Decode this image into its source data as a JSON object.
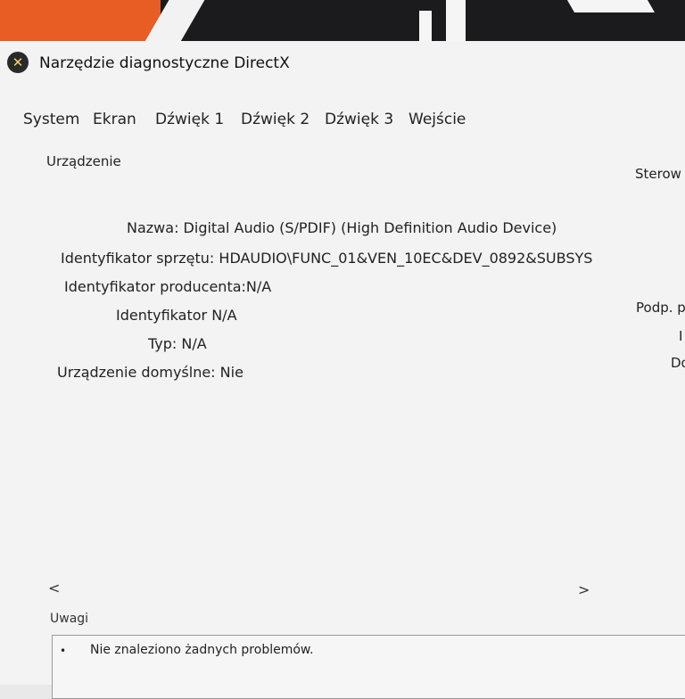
{
  "window": {
    "title": "Narzędzie diagnostyczne DirectX",
    "icon": "directx-icon"
  },
  "tabs": [
    "System",
    "Ekran",
    "Dźwięk 1",
    "Dźwięk 2",
    "Dźwięk 3",
    "Wejście"
  ],
  "device": {
    "group_label": "Urządzenie",
    "fields": [
      {
        "label": "Nazwa:",
        "value": "Digital Audio (S/PDIF) (High Definition Audio Device)"
      },
      {
        "label": "Identyfikator sprzętu:",
        "value": "HDAUDIO\\FUNC_01&VEN_10EC&DEV_0892&SUBSYS"
      },
      {
        "label": "Identyfikator producenta:",
        "value": "N/A"
      },
      {
        "label": "Identyfikator",
        "value": "N/A"
      },
      {
        "label": "Typ:",
        "value": "N/A"
      },
      {
        "label": "Urządzenie domyślne:",
        "value": "Nie"
      }
    ]
  },
  "right_panel": {
    "group_label": "Sterow",
    "labels": [
      "Podp. p",
      "I",
      "Do"
    ]
  },
  "scroll": {
    "left": "<",
    "right": ">"
  },
  "notes": {
    "label": "Uwagi",
    "items": [
      "Nie znaleziono żadnych problemów."
    ]
  }
}
